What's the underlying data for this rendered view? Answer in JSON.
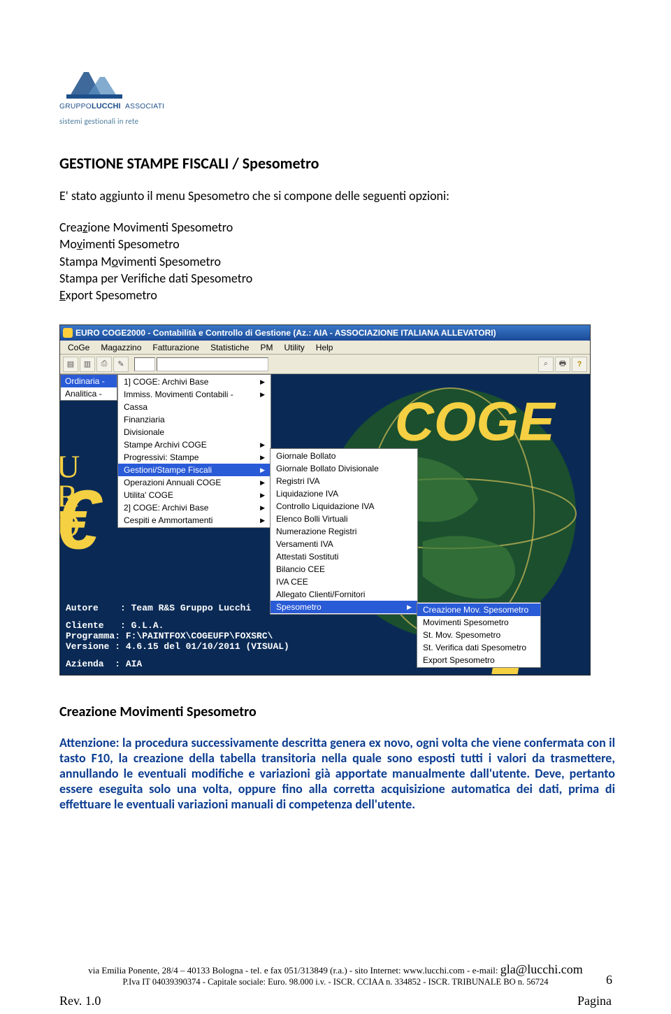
{
  "logo": {
    "line1": "GRUPPO LUCCHI ASSOCIATI",
    "caption": "sistemi gestionali in rete"
  },
  "heading": "GESTIONE STAMPE FISCALI / Spesometro",
  "intro": "E' stato aggiunto il menu Spesometro che si compone delle seguenti opzioni:",
  "options": {
    "o1_pre": "Crea",
    "o1_u": "z",
    "o1_post": "ione Movimenti Spesometro",
    "o2_pre": "Mo",
    "o2_u": "v",
    "o2_post": "imenti Spesometro",
    "o3_pre": "Stampa M",
    "o3_u": "o",
    "o3_post": "vimenti Spesometro",
    "o4": "Stampa per Verifiche dati Spesometro",
    "o5_u": "E",
    "o5_post": "xport Spesometro"
  },
  "screenshot": {
    "title": "EURO COGE2000 - Contabilità e Controllo di Gestione (Az.: AIA - ASSOCIAZIONE ITALIANA ALLEVATORI)",
    "menubar": [
      "CoGe",
      "Magazzino",
      "Fatturazione",
      "Statistiche",
      "PM",
      "Utility",
      "Help"
    ],
    "sidebar": [
      "Ordinaria -",
      "Analitica -"
    ],
    "menu1": [
      {
        "l": "1] COGE: Archivi Base",
        "a": true
      },
      {
        "l": "Immiss. Movimenti Contabili -",
        "a": true
      },
      {
        "l": "Cassa",
        "a": false
      },
      {
        "l": "Finanziaria",
        "a": false
      },
      {
        "l": "Divisionale",
        "a": false
      },
      {
        "l": "Stampe Archivi COGE",
        "a": true
      },
      {
        "l": "Progressivi: Stampe",
        "a": true
      },
      {
        "l": "Gestioni/Stampe Fiscali",
        "a": true,
        "hl": true
      },
      {
        "l": "Operazioni Annuali COGE",
        "a": true
      },
      {
        "l": "Utilita' COGE",
        "a": true
      },
      {
        "l": "2] COGE: Archivi Base",
        "a": true
      },
      {
        "l": "Cespiti e Ammortamenti",
        "a": true
      }
    ],
    "menu2": [
      {
        "l": "Giornale Bollato",
        "a": false
      },
      {
        "l": "Giornale Bollato Divisionale",
        "a": false
      },
      {
        "l": "Registri IVA",
        "a": false
      },
      {
        "l": "Liquidazione IVA",
        "a": false
      },
      {
        "l": "Controllo Liquidazione IVA",
        "a": false
      },
      {
        "l": "Elenco Bolli Virtuali",
        "a": false
      },
      {
        "l": "Numerazione Registri",
        "a": false
      },
      {
        "l": "Versamenti IVA",
        "a": false
      },
      {
        "l": "Attestati Sostituti",
        "a": false
      },
      {
        "l": "Bilancio CEE",
        "a": false
      },
      {
        "l": "IVA CEE",
        "a": false
      },
      {
        "l": "Allegato Clienti/Fornitori",
        "a": false
      },
      {
        "l": "Spesometro",
        "a": true,
        "hl": true
      }
    ],
    "menu3": [
      {
        "l": "Creazione Mov. Spesometro",
        "hl": true
      },
      {
        "l": "Movimenti Spesometro"
      },
      {
        "l": "St. Mov. Spesometro"
      },
      {
        "l": "St. Verifica dati Spesometro"
      },
      {
        "l": "Export Spesometro"
      }
    ],
    "info": {
      "autore": "Autore    : Team R&S Gruppo Lucchi",
      "cliente": "Cliente   : G.L.A.",
      "programma": "Programma: F:\\PAINTFOX\\COGEUFP\\FOXSRC\\",
      "versione": "Versione : 4.6.15 del 01/10/2011 (VISUAL)",
      "azienda": "Azienda  : AIA"
    }
  },
  "section_title": "Creazione Movimenti Spesometro",
  "warning": "Attenzione: la procedura successivamente descritta genera ex novo, ogni volta che viene confermata con il tasto F10, la creazione della tabella transitoria nella quale sono esposti tutti i valori da trasmettere, annullando le eventuali modifiche e variazioni già apportate manualmente dall'utente. Deve, pertanto essere eseguita solo una volta, oppure fino alla corretta acquisizione automatica dei dati, prima di effettuare le eventuali variazioni manuali di competenza dell'utente.",
  "footer": {
    "line1a": "via Emilia Ponente, 28/4 – 40133 Bologna - tel. e fax 051/313849 (r.a.) - sito Internet: www.lucchi.com - e-mail: ",
    "email": "gla@lucchi.com",
    "line2": "P.Iva IT 04039390374 - Capitale sociale: Euro. 98.000 i.v. - ISCR. CCIAA n. 334852 - ISCR. TRIBUNALE BO n. 56724"
  },
  "page_num": "6",
  "rev": "Rev. 1.0",
  "pagina": "Pagina"
}
